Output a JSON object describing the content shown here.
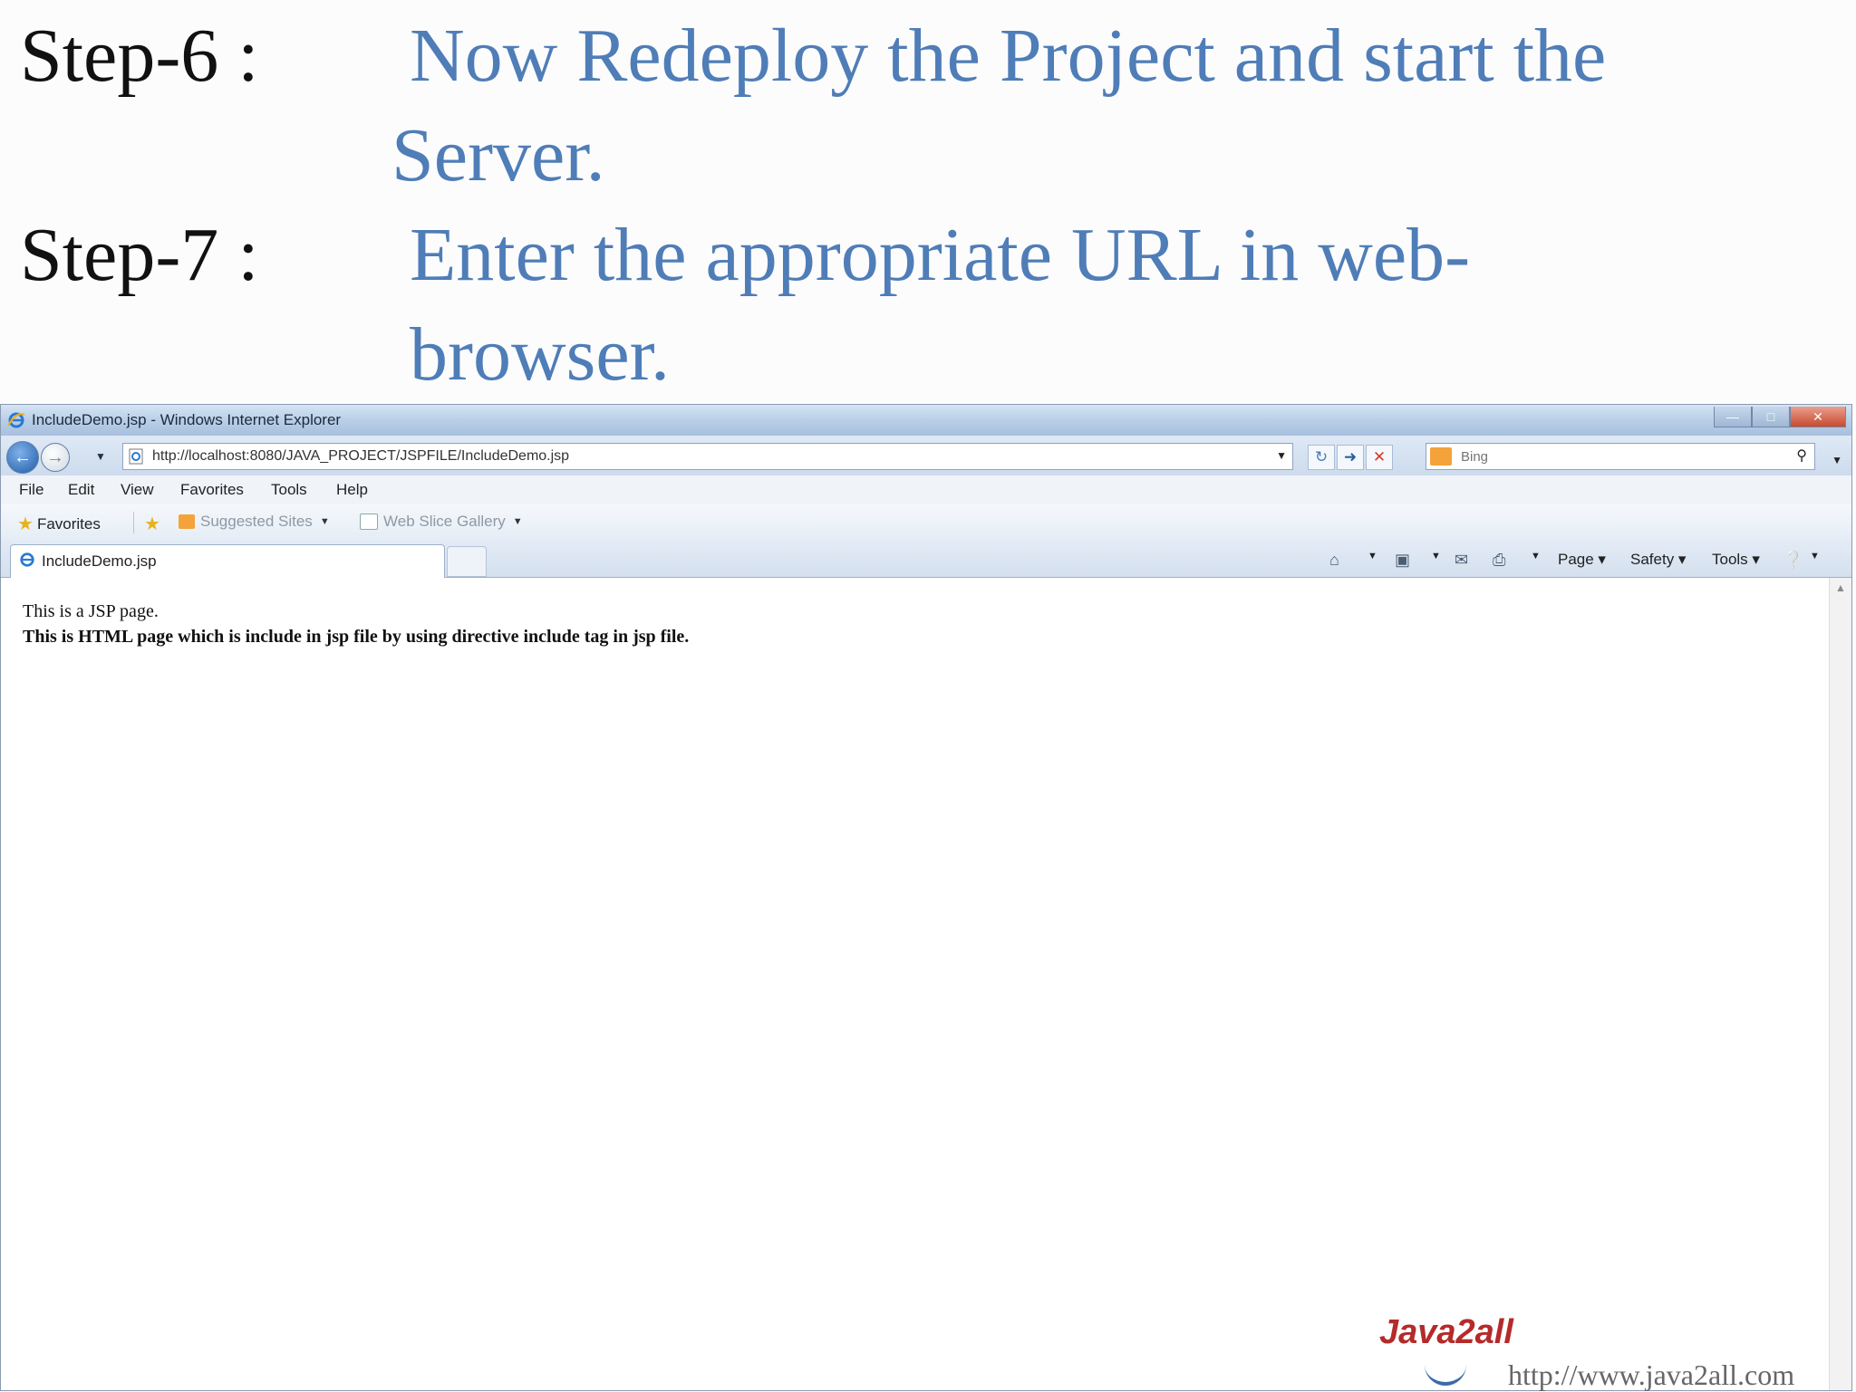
{
  "slide": {
    "step6": {
      "label": "Step-6 :",
      "line1": "Now Redeploy the Project and start the",
      "line2": "Server."
    },
    "step7": {
      "label": "Step-7 :",
      "line1": "Enter the appropriate URL in web-",
      "line2": "browser."
    },
    "footer": {
      "logo_text": "Java2all",
      "url": "http://www.java2all.com"
    }
  },
  "browser": {
    "window_title": "IncludeDemo.jsp - Windows Internet Explorer",
    "address": "http://localhost:8080/JAVA_PROJECT/JSPFILE/IncludeDemo.jsp",
    "search_placeholder": "Bing",
    "menu": [
      "File",
      "Edit",
      "View",
      "Favorites",
      "Tools",
      "Help"
    ],
    "favorites": {
      "label": "Favorites",
      "suggested": "Suggested Sites",
      "web_slice": "Web Slice Gallery"
    },
    "tab_title": "IncludeDemo.jsp",
    "commands": {
      "page": "Page",
      "safety": "Safety",
      "tools": "Tools"
    },
    "content": {
      "line1": "This is a JSP page.",
      "line2": "This is HTML page which is include in jsp file by using directive include tag in jsp file."
    }
  },
  "colors": {
    "step_text": "#4f7db7",
    "label_text": "#111111",
    "logo_red": "#b52a2a"
  },
  "icons": [
    "ie-icon",
    "back-arrow-icon",
    "forward-arrow-icon",
    "refresh-icon",
    "go-icon",
    "stop-icon",
    "search-icon",
    "star-icon",
    "home-icon",
    "feeds-icon",
    "mail-icon",
    "print-icon",
    "help-icon"
  ]
}
